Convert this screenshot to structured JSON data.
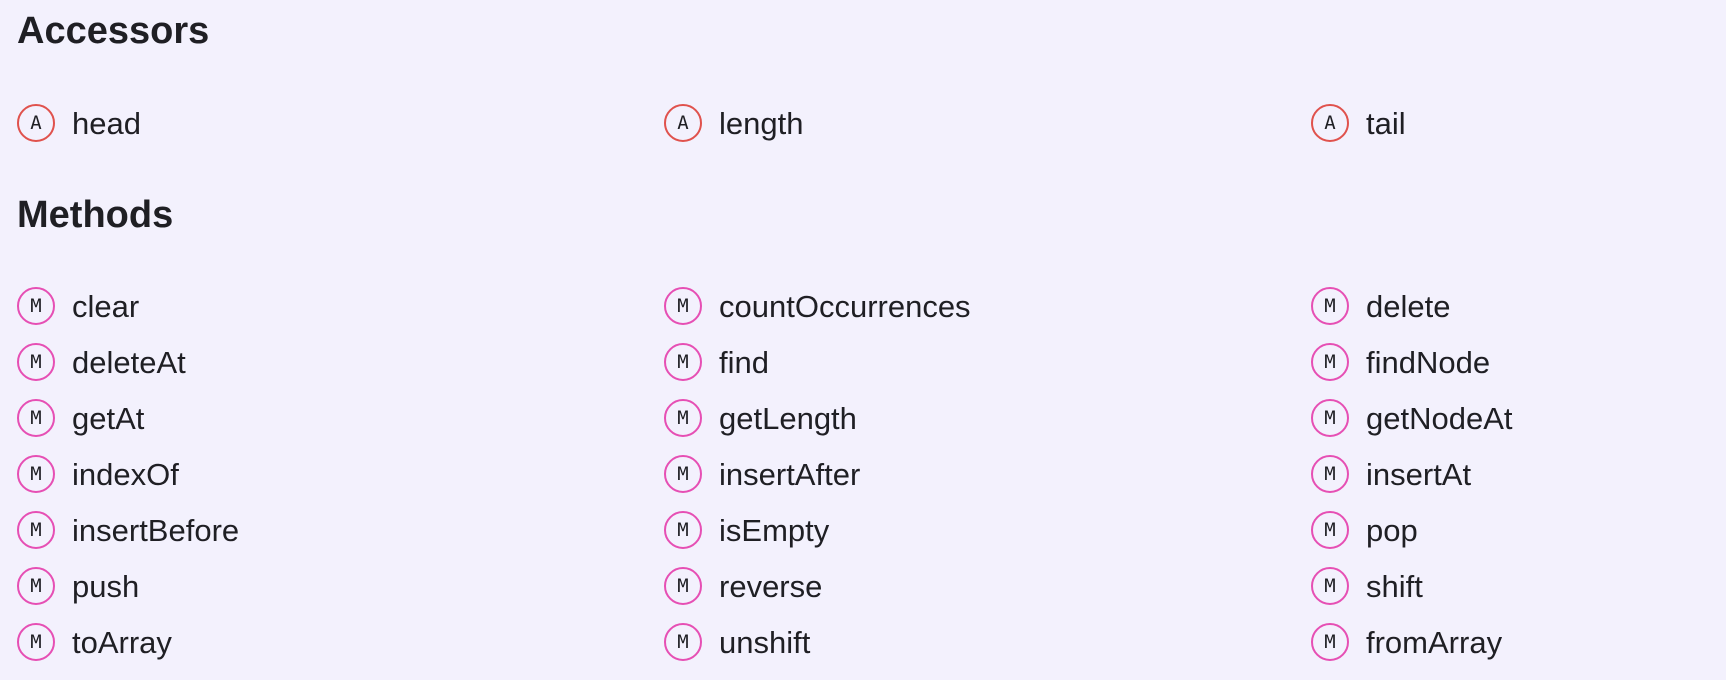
{
  "colors": {
    "background": "#f3f1fd",
    "text": "#1f1f24",
    "accessor_badge": "#e0524d",
    "method_badge": "#e64fb4"
  },
  "accessors": {
    "title": "Accessors",
    "badge_letter": "A",
    "icon": "accessor-badge-icon",
    "items": [
      "head",
      "length",
      "tail"
    ]
  },
  "methods": {
    "title": "Methods",
    "badge_letter": "M",
    "icon": "method-badge-icon",
    "items": [
      "clear",
      "countOccurrences",
      "delete",
      "deleteAt",
      "find",
      "findNode",
      "getAt",
      "getLength",
      "getNodeAt",
      "indexOf",
      "insertAfter",
      "insertAt",
      "insertBefore",
      "isEmpty",
      "pop",
      "push",
      "reverse",
      "shift",
      "toArray",
      "unshift",
      "fromArray"
    ]
  }
}
